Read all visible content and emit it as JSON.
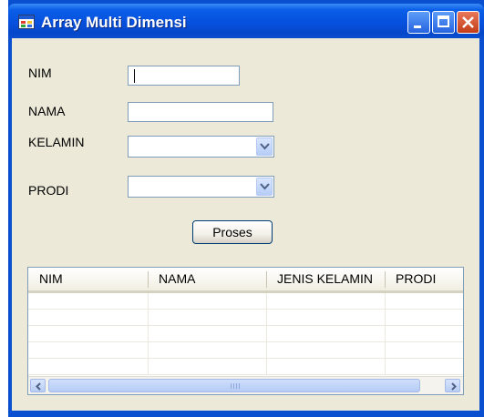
{
  "window": {
    "title": "Array Multi Dimensi"
  },
  "form": {
    "nim_label": "NIM",
    "nama_label": "NAMA",
    "kelamin_label": "KELAMIN",
    "prodi_label": "PRODI",
    "nim_value": "",
    "nama_value": "",
    "kelamin_value": "",
    "prodi_value": "",
    "proses_label": "Proses"
  },
  "grid": {
    "columns": [
      "NIM",
      "NAMA",
      "JENIS KELAMIN",
      "PRODI"
    ],
    "rows": []
  },
  "colors": {
    "titlebar": "#0651df",
    "client": "#ece9d8",
    "border": "#7f9db9"
  }
}
